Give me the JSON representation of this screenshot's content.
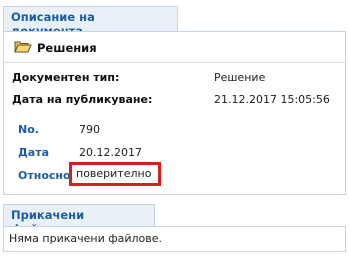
{
  "description": {
    "tab_label": "Описание на документа",
    "heading": "Решения",
    "folder_icon": "folder-open-icon",
    "meta": [
      {
        "label": "Документен тип:",
        "value": "Решение"
      },
      {
        "label": "Дата на публикуване:",
        "value": "21.12.2017 15:05:56"
      }
    ],
    "fields": [
      {
        "label": "No.",
        "value": "790"
      },
      {
        "label": "Дата",
        "value": "20.12.2017"
      },
      {
        "label": "Относно",
        "value": "поверително"
      }
    ],
    "highlight_color": "#d62020",
    "accent_color": "#1b5ea3"
  },
  "attachments": {
    "tab_label": "Прикачени файлове",
    "empty_text": "Няма прикачени файлове."
  }
}
